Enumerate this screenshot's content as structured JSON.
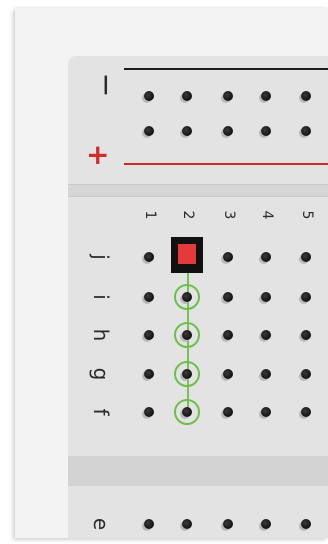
{
  "power_rail": {
    "minus_sign": "−",
    "plus_sign": "+",
    "minus_line_color": "#1b1b1b",
    "plus_line_color": "#cf2a2a"
  },
  "columns": [
    "1",
    "2",
    "3",
    "4",
    "5"
  ],
  "rows": [
    "j",
    "i",
    "h",
    "g",
    "f"
  ],
  "bottom_row_label": "e",
  "highlight": {
    "selected_hole": "j2",
    "selected_color": "#e53a3a",
    "connected_holes": [
      "i2",
      "h2",
      "g2",
      "f2"
    ],
    "connection_color": "#6cc04a"
  }
}
